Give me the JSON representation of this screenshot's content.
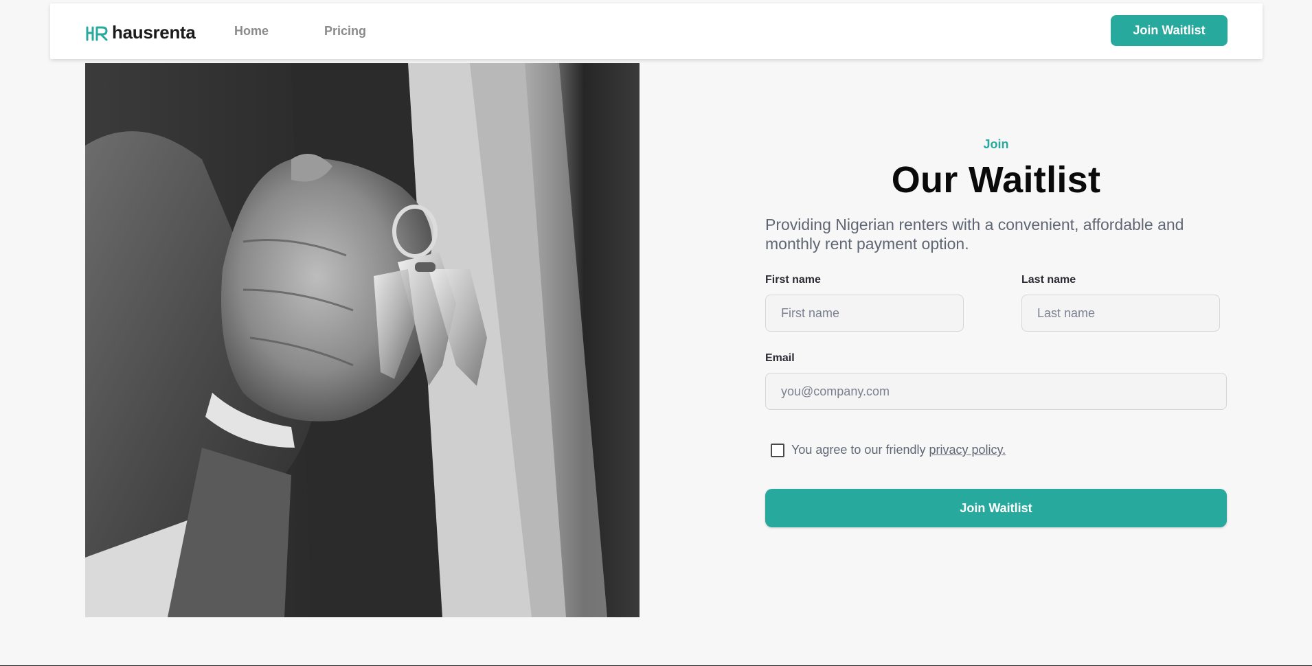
{
  "header": {
    "brand_name": "hausrenta",
    "nav": [
      {
        "label": "Home"
      },
      {
        "label": "Pricing"
      }
    ],
    "cta_label": "Join Waitlist"
  },
  "colors": {
    "accent": "#28a99d",
    "background": "#f7f7f7",
    "text_muted": "#5f6674"
  },
  "hero": {
    "image": "black-and-white photo of a hand in a suit holding a set of keys"
  },
  "form": {
    "eyebrow": "Join",
    "title": "Our Waitlist",
    "subtitle": "Providing Nigerian renters with a convenient, affordable and monthly rent payment option.",
    "first_name": {
      "label": "First name",
      "placeholder": "First name",
      "value": ""
    },
    "last_name": {
      "label": "Last name",
      "placeholder": "Last name",
      "value": ""
    },
    "email": {
      "label": "Email",
      "placeholder": "you@company.com",
      "value": ""
    },
    "consent": {
      "text": "You agree to our friendly",
      "link": "privacy policy.",
      "checked": false
    },
    "submit_label": "Join Waitlist"
  }
}
